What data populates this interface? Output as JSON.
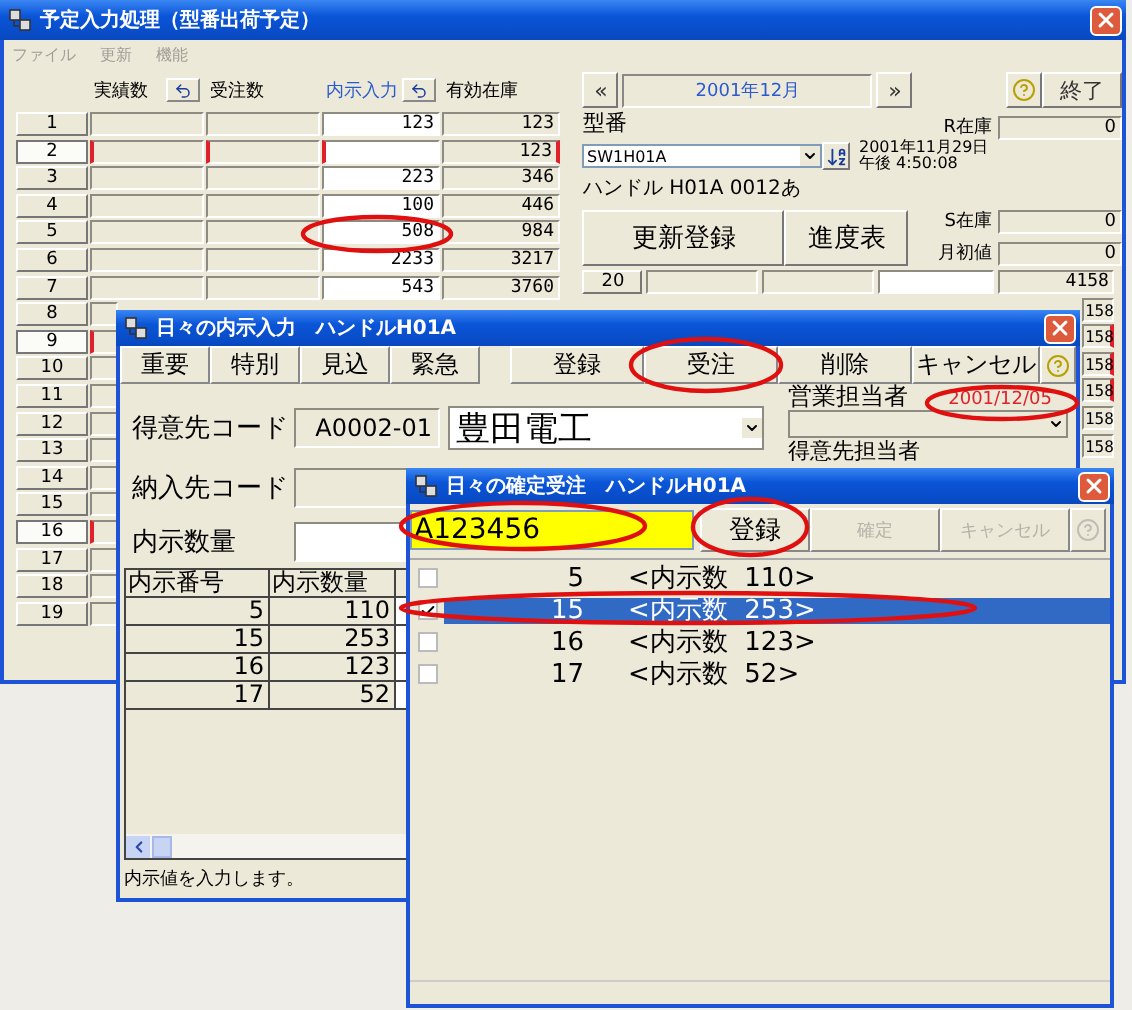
{
  "main_window": {
    "title": "予定入力処理（型番出荷予定）",
    "menu": [
      {
        "label": "ファイル",
        "disabled": true
      },
      {
        "label": "更新",
        "disabled": true
      },
      {
        "label": "機能",
        "disabled": true
      }
    ],
    "columns": [
      {
        "label": "実績数",
        "undo": true,
        "highlighted": false
      },
      {
        "label": "受注数",
        "undo": false,
        "highlighted": false
      },
      {
        "label": "内示入力",
        "undo": true,
        "highlighted": true
      },
      {
        "label": "有効在庫",
        "undo": false,
        "highlighted": false
      }
    ],
    "rows": [
      {
        "number": "1",
        "allocation": "123",
        "stock": "123",
        "marked": false
      },
      {
        "number": "2",
        "stock": "123",
        "marked": true
      },
      {
        "number": "3",
        "allocation": "223",
        "stock": "346",
        "marked": false
      },
      {
        "number": "4",
        "allocation": "100",
        "stock": "446",
        "marked": false
      },
      {
        "number": "5",
        "allocation": "508",
        "stock": "984",
        "marked": false
      },
      {
        "number": "6",
        "allocation": "2233",
        "stock": "3217",
        "marked": false
      },
      {
        "number": "7",
        "allocation": "543",
        "stock": "3760",
        "marked": false
      },
      {
        "number": "8",
        "marked": false
      },
      {
        "number": "9",
        "marked": true
      },
      {
        "number": "10",
        "marked": false
      },
      {
        "number": "11",
        "marked": false
      },
      {
        "number": "12",
        "marked": false
      },
      {
        "number": "13",
        "marked": false
      },
      {
        "number": "14",
        "marked": false
      },
      {
        "number": "15",
        "marked": false
      },
      {
        "number": "16",
        "marked": true
      },
      {
        "number": "17",
        "marked": false
      },
      {
        "number": "18",
        "marked": false
      },
      {
        "number": "19",
        "marked": false
      }
    ],
    "prev": "«",
    "month": "2001年12月",
    "next": "»",
    "exit_button": "終了",
    "model_label": "型番",
    "model": "SW1H01A",
    "timestamp": [
      "2001年11月29日",
      "午後 4:50:08"
    ],
    "product": "ハンドル H01A 0012あ",
    "r_stock": {
      "label": "R在庫",
      "value": "0"
    },
    "update_button": "更新登録",
    "progress_button": "進度表",
    "s_stock": {
      "label": "S在庫",
      "value": "0"
    },
    "month_start": {
      "label": "月初値",
      "value": "0"
    },
    "right_rows": [
      {
        "number": "20",
        "stock": "4158",
        "marked": false
      },
      {
        "stock": "158",
        "marked": false
      },
      {
        "stock": "158",
        "marked": true
      },
      {
        "stock": "158",
        "marked": true
      },
      {
        "stock": "158",
        "marked": true
      },
      {
        "stock": "158",
        "marked": false
      },
      {
        "stock": "158",
        "marked": false
      }
    ]
  },
  "input_window": {
    "title": "日々の内示入力　ハンドルH01A",
    "category_buttons": [
      "重要",
      "特別",
      "見込",
      "緊急"
    ],
    "action_buttons": [
      "登録",
      "受注",
      "削除",
      "キャンセル"
    ],
    "customer_code_label": "得意先コード",
    "customer_code": "A0002-01",
    "customer_name": "豊田電工",
    "delivery_code_label": "納入先コード",
    "quantity_label": "内示数量",
    "sales_rep_label": "営業担当者",
    "date": "2001/12/05",
    "contact_label": "得意先担当者",
    "grid": {
      "columns": [
        "内示番号",
        "内示数量"
      ],
      "rows": [
        [
          "5",
          "110"
        ],
        [
          "15",
          "253"
        ],
        [
          "16",
          "123"
        ],
        [
          "17",
          "52"
        ]
      ]
    },
    "status": "内示値を入力します。"
  },
  "order_window": {
    "title": "日々の確定受注　ハンドルH01A",
    "order_input": "A123456",
    "buttons": [
      {
        "label": "登録",
        "disabled": false
      },
      {
        "label": "確定",
        "disabled": true
      },
      {
        "label": "キャンセル",
        "disabled": true
      }
    ],
    "help_disabled": true,
    "items": [
      {
        "number": "5",
        "text": "<内示数  110>",
        "checked": false,
        "selected": false
      },
      {
        "number": "15",
        "text": "<内示数  253>",
        "checked": true,
        "selected": true
      },
      {
        "number": "16",
        "text": "<内示数  123>",
        "checked": false,
        "selected": false
      },
      {
        "number": "17",
        "text": "<内示数  52>",
        "checked": false,
        "selected": false
      }
    ]
  }
}
